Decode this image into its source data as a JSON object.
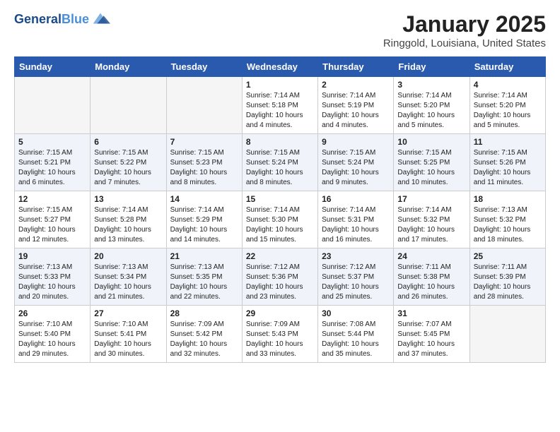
{
  "header": {
    "logo_line1": "General",
    "logo_line2": "Blue",
    "title": "January 2025",
    "subtitle": "Ringgold, Louisiana, United States"
  },
  "weekdays": [
    "Sunday",
    "Monday",
    "Tuesday",
    "Wednesday",
    "Thursday",
    "Friday",
    "Saturday"
  ],
  "weeks": [
    [
      {
        "day": "",
        "info": ""
      },
      {
        "day": "",
        "info": ""
      },
      {
        "day": "",
        "info": ""
      },
      {
        "day": "1",
        "info": "Sunrise: 7:14 AM\nSunset: 5:18 PM\nDaylight: 10 hours\nand 4 minutes."
      },
      {
        "day": "2",
        "info": "Sunrise: 7:14 AM\nSunset: 5:19 PM\nDaylight: 10 hours\nand 4 minutes."
      },
      {
        "day": "3",
        "info": "Sunrise: 7:14 AM\nSunset: 5:20 PM\nDaylight: 10 hours\nand 5 minutes."
      },
      {
        "day": "4",
        "info": "Sunrise: 7:14 AM\nSunset: 5:20 PM\nDaylight: 10 hours\nand 5 minutes."
      }
    ],
    [
      {
        "day": "5",
        "info": "Sunrise: 7:15 AM\nSunset: 5:21 PM\nDaylight: 10 hours\nand 6 minutes."
      },
      {
        "day": "6",
        "info": "Sunrise: 7:15 AM\nSunset: 5:22 PM\nDaylight: 10 hours\nand 7 minutes."
      },
      {
        "day": "7",
        "info": "Sunrise: 7:15 AM\nSunset: 5:23 PM\nDaylight: 10 hours\nand 8 minutes."
      },
      {
        "day": "8",
        "info": "Sunrise: 7:15 AM\nSunset: 5:24 PM\nDaylight: 10 hours\nand 8 minutes."
      },
      {
        "day": "9",
        "info": "Sunrise: 7:15 AM\nSunset: 5:24 PM\nDaylight: 10 hours\nand 9 minutes."
      },
      {
        "day": "10",
        "info": "Sunrise: 7:15 AM\nSunset: 5:25 PM\nDaylight: 10 hours\nand 10 minutes."
      },
      {
        "day": "11",
        "info": "Sunrise: 7:15 AM\nSunset: 5:26 PM\nDaylight: 10 hours\nand 11 minutes."
      }
    ],
    [
      {
        "day": "12",
        "info": "Sunrise: 7:15 AM\nSunset: 5:27 PM\nDaylight: 10 hours\nand 12 minutes."
      },
      {
        "day": "13",
        "info": "Sunrise: 7:14 AM\nSunset: 5:28 PM\nDaylight: 10 hours\nand 13 minutes."
      },
      {
        "day": "14",
        "info": "Sunrise: 7:14 AM\nSunset: 5:29 PM\nDaylight: 10 hours\nand 14 minutes."
      },
      {
        "day": "15",
        "info": "Sunrise: 7:14 AM\nSunset: 5:30 PM\nDaylight: 10 hours\nand 15 minutes."
      },
      {
        "day": "16",
        "info": "Sunrise: 7:14 AM\nSunset: 5:31 PM\nDaylight: 10 hours\nand 16 minutes."
      },
      {
        "day": "17",
        "info": "Sunrise: 7:14 AM\nSunset: 5:32 PM\nDaylight: 10 hours\nand 17 minutes."
      },
      {
        "day": "18",
        "info": "Sunrise: 7:13 AM\nSunset: 5:32 PM\nDaylight: 10 hours\nand 18 minutes."
      }
    ],
    [
      {
        "day": "19",
        "info": "Sunrise: 7:13 AM\nSunset: 5:33 PM\nDaylight: 10 hours\nand 20 minutes."
      },
      {
        "day": "20",
        "info": "Sunrise: 7:13 AM\nSunset: 5:34 PM\nDaylight: 10 hours\nand 21 minutes."
      },
      {
        "day": "21",
        "info": "Sunrise: 7:13 AM\nSunset: 5:35 PM\nDaylight: 10 hours\nand 22 minutes."
      },
      {
        "day": "22",
        "info": "Sunrise: 7:12 AM\nSunset: 5:36 PM\nDaylight: 10 hours\nand 23 minutes."
      },
      {
        "day": "23",
        "info": "Sunrise: 7:12 AM\nSunset: 5:37 PM\nDaylight: 10 hours\nand 25 minutes."
      },
      {
        "day": "24",
        "info": "Sunrise: 7:11 AM\nSunset: 5:38 PM\nDaylight: 10 hours\nand 26 minutes."
      },
      {
        "day": "25",
        "info": "Sunrise: 7:11 AM\nSunset: 5:39 PM\nDaylight: 10 hours\nand 28 minutes."
      }
    ],
    [
      {
        "day": "26",
        "info": "Sunrise: 7:10 AM\nSunset: 5:40 PM\nDaylight: 10 hours\nand 29 minutes."
      },
      {
        "day": "27",
        "info": "Sunrise: 7:10 AM\nSunset: 5:41 PM\nDaylight: 10 hours\nand 30 minutes."
      },
      {
        "day": "28",
        "info": "Sunrise: 7:09 AM\nSunset: 5:42 PM\nDaylight: 10 hours\nand 32 minutes."
      },
      {
        "day": "29",
        "info": "Sunrise: 7:09 AM\nSunset: 5:43 PM\nDaylight: 10 hours\nand 33 minutes."
      },
      {
        "day": "30",
        "info": "Sunrise: 7:08 AM\nSunset: 5:44 PM\nDaylight: 10 hours\nand 35 minutes."
      },
      {
        "day": "31",
        "info": "Sunrise: 7:07 AM\nSunset: 5:45 PM\nDaylight: 10 hours\nand 37 minutes."
      },
      {
        "day": "",
        "info": ""
      }
    ]
  ]
}
